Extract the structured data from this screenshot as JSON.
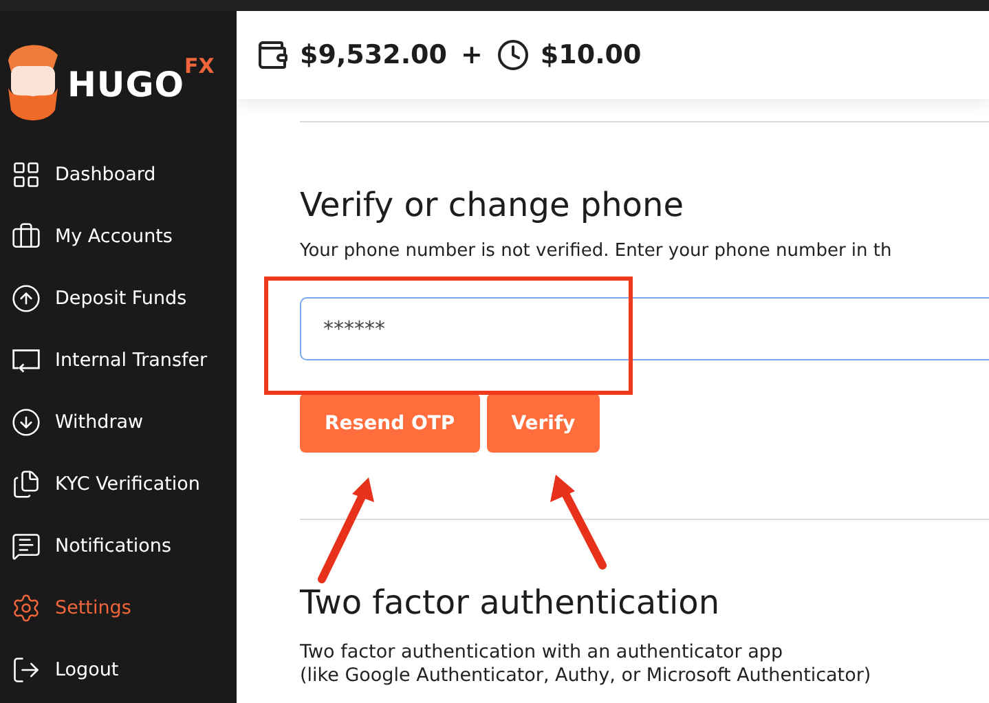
{
  "brand": {
    "name": "HUGO",
    "suffix": "FX"
  },
  "sidebar": {
    "items": [
      {
        "label": "Dashboard",
        "kind": "grid",
        "selected": false
      },
      {
        "label": "My Accounts",
        "kind": "briefcase",
        "selected": false
      },
      {
        "label": "Deposit Funds",
        "kind": "up",
        "selected": false
      },
      {
        "label": "Internal Transfer",
        "kind": "transfer",
        "selected": false
      },
      {
        "label": "Withdraw",
        "kind": "down",
        "selected": false
      },
      {
        "label": "KYC Verification",
        "kind": "files",
        "selected": false
      },
      {
        "label": "Notifications",
        "kind": "message",
        "selected": false
      },
      {
        "label": "Settings",
        "kind": "settings",
        "selected": true
      },
      {
        "label": "Logout",
        "kind": "logout",
        "selected": false
      }
    ]
  },
  "header": {
    "balance": "$9,532.00",
    "separator": "+",
    "pending": "$10.00"
  },
  "phone_section": {
    "title": "Verify or change phone",
    "description": "Your phone number is not verified. Enter your phone number in th",
    "input_value": "******",
    "buttons": [
      "Resend OTP",
      "Verify"
    ]
  },
  "two_factor": {
    "title": "Two factor authentication",
    "lines": [
      "Two factor authentication with an authenticator app",
      "(like Google Authenticator, Authy, or Microsoft Authenticator)"
    ]
  },
  "annotations": [
    {
      "kind": "box"
    },
    {
      "kind": "arrow"
    },
    {
      "kind": "arrow"
    }
  ]
}
